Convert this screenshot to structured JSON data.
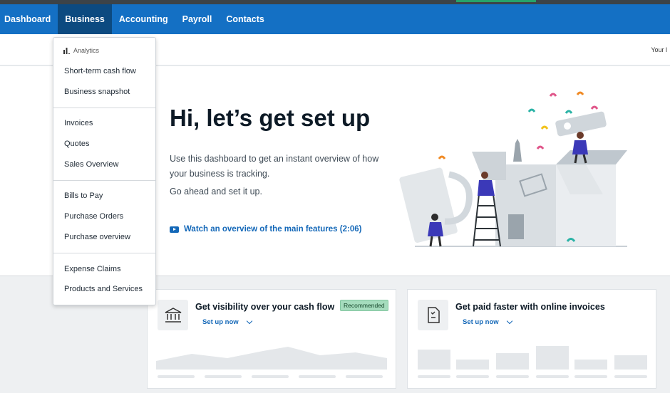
{
  "nav": {
    "items": [
      "Dashboard",
      "Business",
      "Accounting",
      "Payroll",
      "Contacts"
    ],
    "active": "Business"
  },
  "subbar": {
    "right_text": "Your l"
  },
  "hero": {
    "title": "Hi, let’s get set up",
    "text1": "Use this dashboard to get an instant overview of how your business is tracking.",
    "text2": "Go ahead and set it up.",
    "video_link": "Watch an overview of the main features (2:06)",
    "video_icon": "play-video-icon"
  },
  "cards": [
    {
      "title": "Get visibility over your cash flow",
      "badge": "Recommended",
      "link": "Set up now",
      "icon": "bank-icon"
    },
    {
      "title": "Get paid faster with online invoices",
      "link": "Set up now",
      "icon": "invoice-icon"
    }
  ],
  "dropdown": {
    "heading": "Analytics",
    "heading_icon": "bar-chart-icon",
    "groups": [
      [
        "Short-term cash flow",
        "Business snapshot"
      ],
      [
        "Invoices",
        "Quotes",
        "Sales Overview"
      ],
      [
        "Bills to Pay",
        "Purchase Orders",
        "Purchase overview"
      ],
      [
        "Expense Claims",
        "Products and Services"
      ]
    ]
  },
  "colors": {
    "nav_bg": "#1470c4",
    "nav_active": "#0c4a80",
    "link": "#1468b8",
    "badge_bg": "#a5dcbd"
  }
}
